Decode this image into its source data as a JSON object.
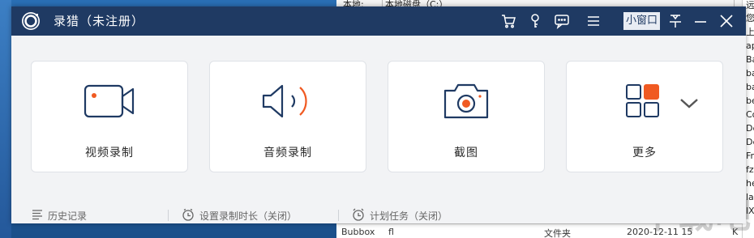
{
  "background": {
    "explorer_columns": [
      "本地:",
      "本地磁盘（C:）",
      "远程"
    ],
    "explorer_right_rows": [
      "您",
      "上",
      "ap",
      "Ba",
      "ba",
      "ba",
      "be",
      "Co",
      "De",
      "De",
      "Fr",
      "fz",
      "he",
      "lav",
      "lX"
    ],
    "explorer_bottom_row": [
      "Bubbox",
      "fl",
      "文件夹",
      "2020-12-11 15",
      "K"
    ],
    "watermark": "下载吧"
  },
  "titlebar": {
    "title": "录猎（未注册）",
    "mini_window_label": "小窗口",
    "icons": [
      "cart-icon",
      "key-icon",
      "feedback-icon",
      "menu-icon",
      "pin-icon",
      "minimize-icon",
      "close-icon"
    ]
  },
  "cards": [
    {
      "label": "视频录制",
      "icon": "video-camera-icon"
    },
    {
      "label": "音频录制",
      "icon": "speaker-icon"
    },
    {
      "label": "截图",
      "icon": "camera-icon"
    },
    {
      "label": "更多",
      "icon": "grid-icon"
    }
  ],
  "bottombar": {
    "history": "历史记录",
    "set_duration": "设置录制时长（关闭）",
    "schedule": "计划任务（关闭）"
  },
  "colors": {
    "titlebar": "#1f3a63",
    "accent": "#f05a22",
    "icon_stroke": "#1f3a63",
    "window_bg": "#f2f3f5"
  }
}
